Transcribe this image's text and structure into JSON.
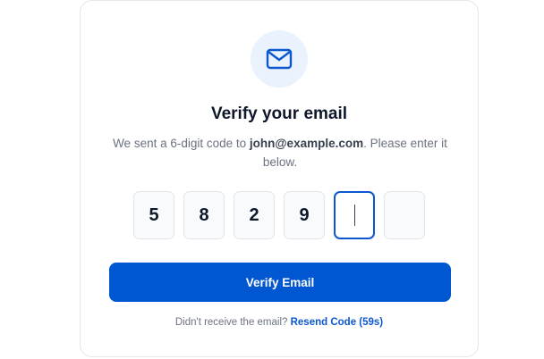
{
  "verify": {
    "title": "Verify your email",
    "subtitle_prefix": "We sent a 6-digit code to ",
    "email": "john@example.com",
    "subtitle_suffix": ". Please enter it below.",
    "code_digits": [
      "5",
      "8",
      "2",
      "9",
      "",
      ""
    ],
    "active_index": 4,
    "button_label": "Verify Email",
    "resend_prompt": "Didn't receive the email?",
    "resend_link": "Resend Code (59s)"
  },
  "icons": {
    "header": "mail-icon"
  },
  "colors": {
    "accent": "#0156d2",
    "icon_bg": "#eaf2fe"
  }
}
